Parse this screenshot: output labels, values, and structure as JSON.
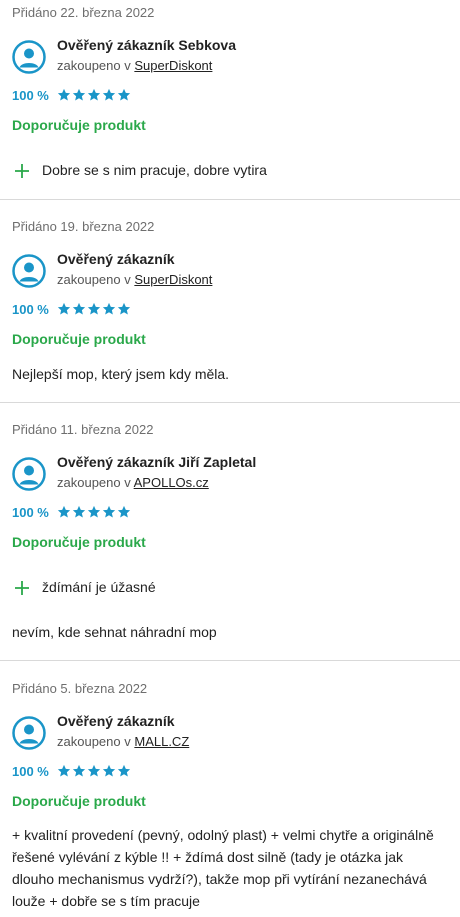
{
  "reviews": [
    {
      "date": "Přidáno 22. března 2022",
      "name": "Ověřený zákazník Sebkova",
      "bought_prefix": "zakoupeno v",
      "shop": "SuperDiskont",
      "rating_pct": "100 %",
      "stars": 5,
      "recommend": "Doporučuje produkt",
      "pros": [
        "Dobre se s nim pracuje, dobre vytira"
      ],
      "text": ""
    },
    {
      "date": "Přidáno 19. března 2022",
      "name": "Ověřený zákazník",
      "bought_prefix": "zakoupeno v",
      "shop": "SuperDiskont",
      "rating_pct": "100 %",
      "stars": 5,
      "recommend": "Doporučuje produkt",
      "pros": [],
      "text": "Nejlepší mop, který jsem kdy měla."
    },
    {
      "date": "Přidáno 11. března 2022",
      "name": "Ověřený zákazník Jiří Zapletal",
      "bought_prefix": "zakoupeno v",
      "shop": "APOLLOs.cz",
      "rating_pct": "100 %",
      "stars": 5,
      "recommend": "Doporučuje produkt",
      "pros": [
        "ždímání je úžasné"
      ],
      "text": "nevím, kde sehnat náhradní mop"
    },
    {
      "date": "Přidáno 5. března 2022",
      "name": "Ověřený zákazník",
      "bought_prefix": "zakoupeno v",
      "shop": "MALL.CZ",
      "rating_pct": "100 %",
      "stars": 5,
      "recommend": "Doporučuje produkt",
      "pros": [],
      "text": "+ kvalitní provedení (pevný, odolný plast) + velmi chytře a originálně řešené vylévání z kýble !! + ždímá dost silně (tady je otázka jak dlouho mechanismus vydrží?), takže mop při vytírání nezanechává louže + dobře se s tím pracuje"
    }
  ],
  "colors": {
    "accent_blue": "#1a95c8",
    "recommend_green": "#2aa84a",
    "plus_green": "#2aa84a",
    "divider": "#d9d9d9"
  },
  "icons": {
    "avatar": "user-avatar-icon",
    "star": "star-icon",
    "plus": "plus-icon"
  }
}
